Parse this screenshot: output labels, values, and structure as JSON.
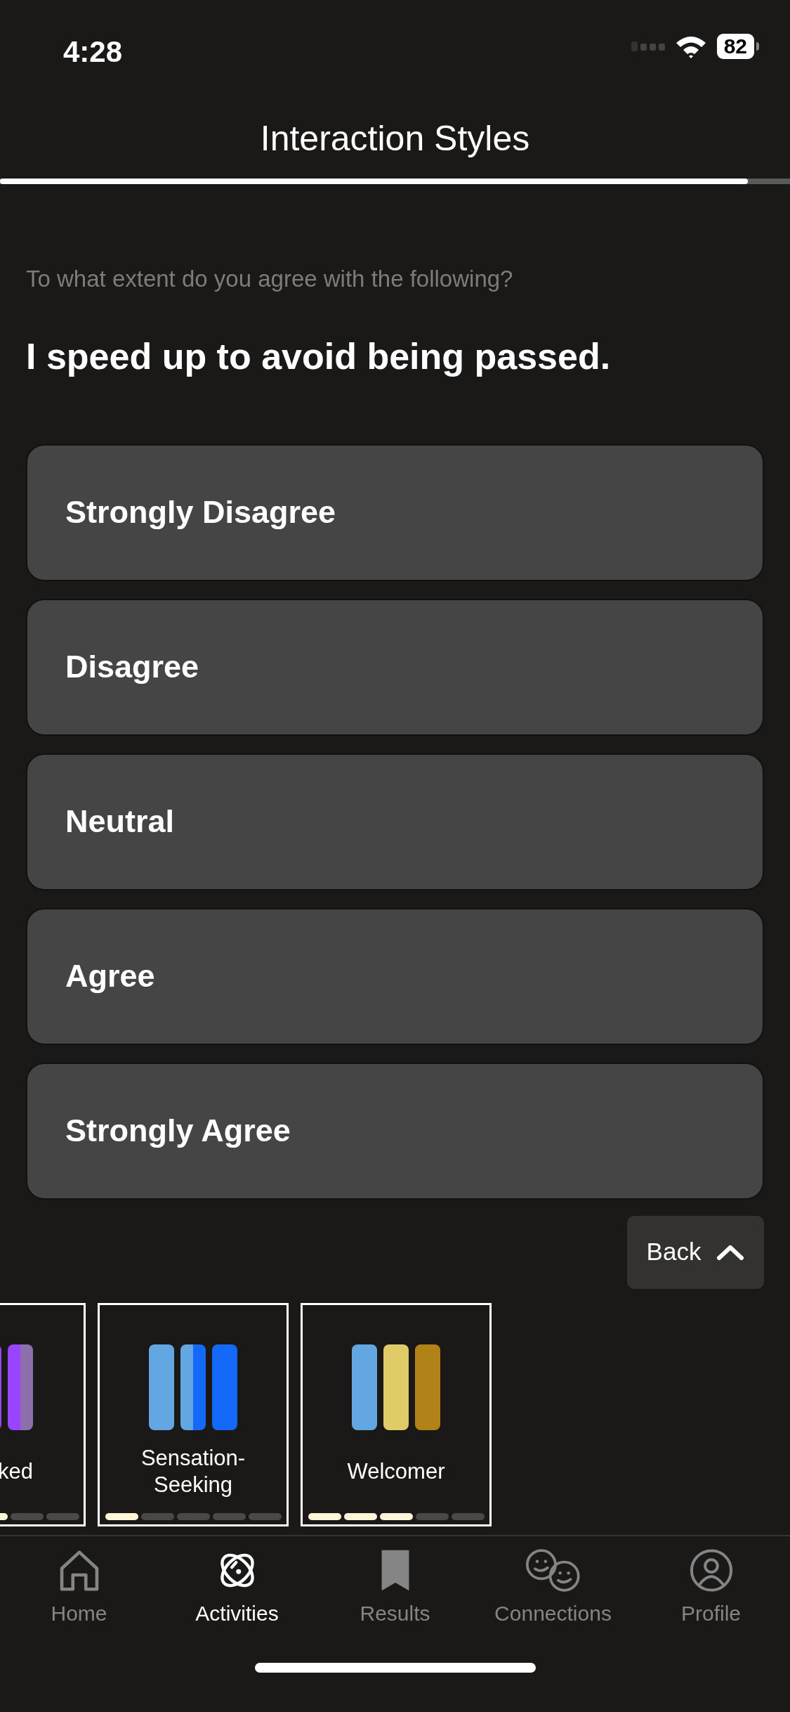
{
  "status_bar": {
    "time": "4:28",
    "battery": "82"
  },
  "header": {
    "title": "Interaction Styles",
    "progress": {
      "level": 0.947
    }
  },
  "prompt": "To what extent do you agree with the following?",
  "question": "I speed up to avoid being passed.",
  "options": [
    {
      "label": "Strongly Disagree",
      "selected": false
    },
    {
      "label": "Disagree",
      "selected": false
    },
    {
      "label": "Neutral",
      "selected": false
    },
    {
      "label": "Agree",
      "selected": false
    },
    {
      "label": "Strongly Agree",
      "selected": false
    }
  ],
  "back_button": {
    "label": "Back"
  },
  "cards": [
    {
      "label": "ked",
      "cut": true,
      "level": 0.6,
      "bars": [
        {
          "parts": [
            {
              "color": "#9945ff"
            }
          ]
        },
        {
          "parts": [
            {
              "color": "#9945ff"
            },
            {
              "color": "#8e6fae"
            }
          ]
        }
      ]
    },
    {
      "label": "Sensation-\nSeeking",
      "cut": false,
      "level": 0.2,
      "bars": [
        {
          "parts": [
            {
              "color": "#62a6e2"
            }
          ]
        },
        {
          "parts": [
            {
              "color": "#62a6e2"
            },
            {
              "color": "#1469f8"
            }
          ]
        },
        {
          "parts": [
            {
              "color": "#1469f8"
            }
          ]
        }
      ]
    },
    {
      "label": "Welcomer",
      "cut": false,
      "level": 0.6,
      "bars": [
        {
          "parts": [
            {
              "color": "#62a6e2"
            }
          ]
        },
        {
          "parts": [
            {
              "color": "#e0cb69"
            }
          ]
        },
        {
          "parts": [
            {
              "color": "#b08217"
            }
          ]
        }
      ]
    }
  ],
  "tab_bar": [
    {
      "label": "Home",
      "kind": "home",
      "selected": false
    },
    {
      "label": "Activities",
      "kind": "activities",
      "selected": true
    },
    {
      "label": "Results",
      "kind": "results",
      "selected": false
    },
    {
      "label": "Connections",
      "kind": "connections",
      "selected": false
    },
    {
      "label": "Profile",
      "kind": "profile",
      "selected": false
    }
  ]
}
